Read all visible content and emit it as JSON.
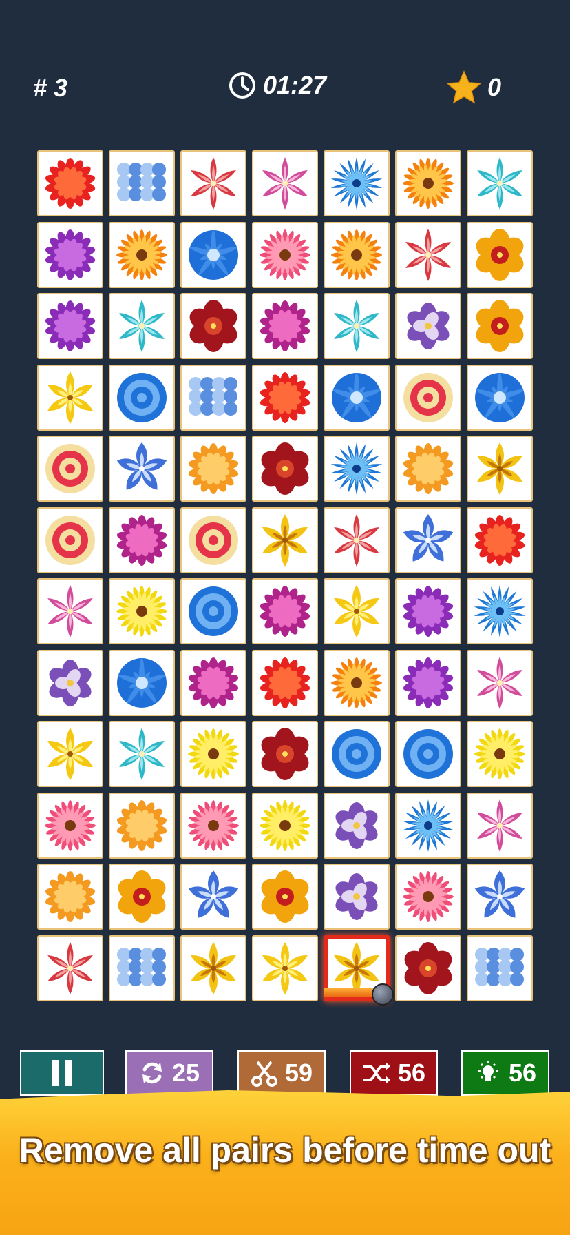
{
  "hud": {
    "level": "# 3",
    "timer": "01:27",
    "score": "0"
  },
  "board": {
    "rows": [
      [
        "red-dahlia",
        "blue-hydrangea",
        "red-lily",
        "pink-lily",
        "blue-cornflower",
        "orange-gerbera",
        "teal-lily"
      ],
      [
        "purple-zinnia",
        "orange-gerbera",
        "blue-morning-glory",
        "pink-gerbera",
        "orange-gerbera",
        "red-lily",
        "yellow-red-lily"
      ],
      [
        "purple-zinnia",
        "teal-lily",
        "dark-red-lily",
        "magenta-aster",
        "teal-lily",
        "purple-iris",
        "yellow-red-lily"
      ],
      [
        "yellow-daylily",
        "blue-rose",
        "blue-hydrangea",
        "red-dahlia",
        "blue-morning-glory",
        "cream-rose",
        "blue-morning-glory"
      ],
      [
        "cream-rose",
        "blue-star-flower",
        "orange-dahlia",
        "dark-red-lily",
        "blue-cornflower",
        "orange-dahlia",
        "yellow-tiger-lily"
      ],
      [
        "cream-rose",
        "magenta-aster",
        "cream-rose",
        "yellow-tiger-lily",
        "red-lily",
        "blue-star-flower",
        "red-dahlia"
      ],
      [
        "pink-lily",
        "yellow-daisy",
        "blue-rose",
        "magenta-aster",
        "yellow-daylily",
        "purple-zinnia",
        "blue-cornflower"
      ],
      [
        "purple-iris",
        "blue-morning-glory",
        "magenta-aster",
        "red-dahlia",
        "orange-gerbera",
        "purple-zinnia",
        "pink-lily"
      ],
      [
        "yellow-daylily",
        "teal-lily",
        "yellow-daisy",
        "dark-red-lily",
        "blue-rose",
        "blue-rose",
        "yellow-daisy"
      ],
      [
        "pink-gerbera",
        "orange-dahlia",
        "pink-gerbera",
        "yellow-daisy",
        "purple-iris",
        "blue-cornflower",
        "pink-lily"
      ],
      [
        "orange-dahlia",
        "yellow-red-lily",
        "blue-star-flower",
        "yellow-red-lily",
        "purple-iris",
        "pink-gerbera",
        "blue-star-flower"
      ],
      [
        "red-lily",
        "blue-hydrangea",
        "yellow-tiger-lily",
        "yellow-daylily",
        "yellow-tiger-lily",
        "dark-red-lily",
        "blue-hydrangea"
      ]
    ],
    "selected": {
      "row": 11,
      "col": 4
    },
    "hint_progress": 0.6
  },
  "flower_colors": {
    "red-dahlia": [
      "#e8231f",
      "#ff6a3a"
    ],
    "blue-hydrangea": [
      "#5a8fe0",
      "#a8c8f4"
    ],
    "red-lily": [
      "#d8383f",
      "#f3a0a0"
    ],
    "pink-lily": [
      "#d14d9c",
      "#f7b6d8"
    ],
    "blue-cornflower": [
      "#1e78d4",
      "#6cc0f5"
    ],
    "orange-gerbera": [
      "#f5820f",
      "#ffc64a"
    ],
    "teal-lily": [
      "#2fb8c8",
      "#9ee6ee"
    ],
    "purple-zinnia": [
      "#8a2cb8",
      "#c86be0"
    ],
    "blue-morning-glory": [
      "#1f6fd8",
      "#cfe8ff"
    ],
    "pink-gerbera": [
      "#ef4e78",
      "#ff9ab4"
    ],
    "yellow-red-lily": [
      "#f2a40c",
      "#c31d1d"
    ],
    "dark-red-lily": [
      "#a3151d",
      "#d8452b"
    ],
    "magenta-aster": [
      "#b0238a",
      "#ee6bc2"
    ],
    "purple-iris": [
      "#7a4fb8",
      "#e2d6f2"
    ],
    "yellow-daylily": [
      "#f5c814",
      "#fff07a"
    ],
    "blue-rose": [
      "#1f73d8",
      "#6fb1f2"
    ],
    "cream-rose": [
      "#f4dfa0",
      "#e5344a"
    ],
    "blue-star-flower": [
      "#3f6fd8",
      "#c9dcfb"
    ],
    "orange-dahlia": [
      "#f59a20",
      "#ffcc6a"
    ],
    "yellow-tiger-lily": [
      "#f3c313",
      "#c7780a"
    ],
    "yellow-daisy": [
      "#f2d810",
      "#ffee66"
    ]
  },
  "controls": {
    "pause": {
      "icon": "pause-icon",
      "color": "#1b6b6b"
    },
    "undo": {
      "icon": "refresh-icon",
      "count": "25",
      "color": "#9b6fb6"
    },
    "remove": {
      "icon": "scissors-icon",
      "count": "59",
      "color": "#b06a38"
    },
    "shuffle": {
      "icon": "shuffle-icon",
      "count": "56",
      "color": "#9e1016"
    },
    "hint": {
      "icon": "lightbulb-icon",
      "count": "56",
      "color": "#0d7a14"
    }
  },
  "banner": {
    "text": "Remove all pairs before time out"
  },
  "colors": {
    "background": "#1f2d3f",
    "tile_border": "#e9c37a",
    "selected_border": "#e32a1b",
    "star": "#f5b21a"
  }
}
